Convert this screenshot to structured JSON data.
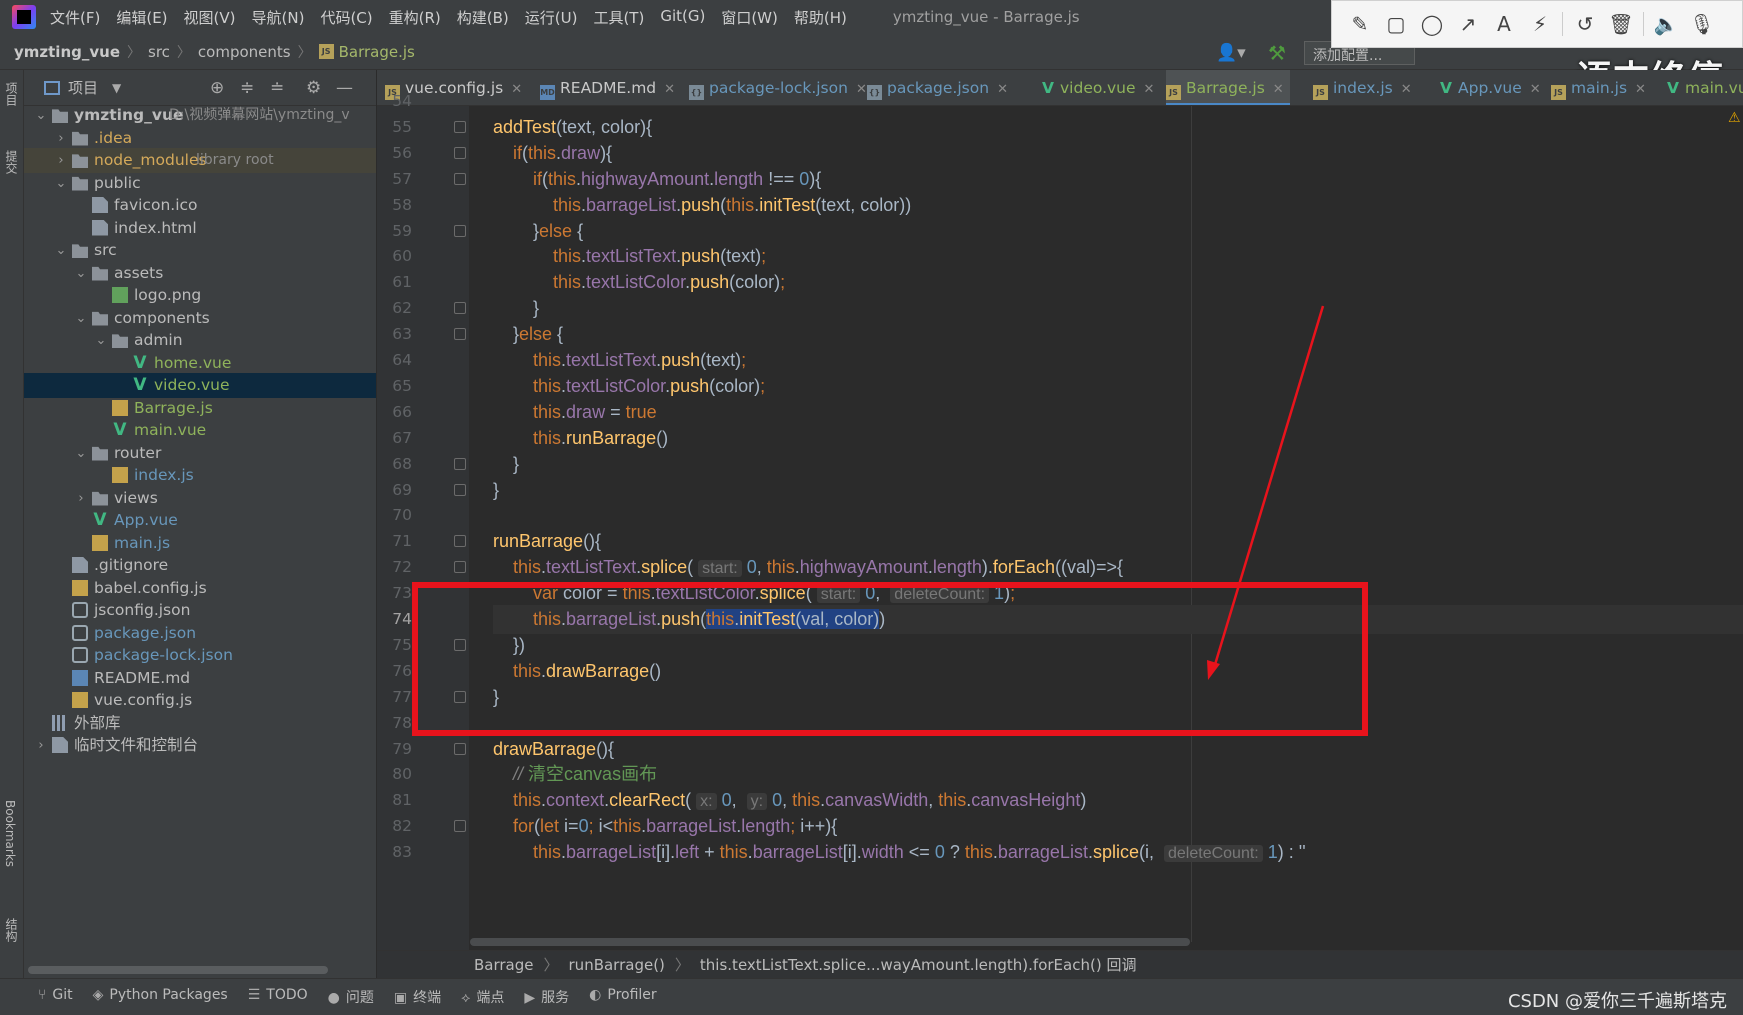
{
  "menubar": {
    "items": [
      "文件(F)",
      "编辑(E)",
      "视图(V)",
      "导航(N)",
      "代码(C)",
      "重构(R)",
      "构建(B)",
      "运行(U)",
      "工具(T)",
      "Git(G)",
      "窗口(W)",
      "帮助(H)"
    ],
    "title": "ymzting_vue - Barrage.js"
  },
  "navbar": {
    "crumbs": [
      "ymzting_vue",
      "src",
      "components",
      "Barrage.js"
    ],
    "run_config": "添加配置..."
  },
  "annotation_toolbar": {
    "tools": [
      "pencil-icon",
      "rectangle-icon",
      "circle-icon",
      "arrow-icon",
      "text-icon",
      "magic-wand-icon",
      "undo-icon",
      "trash-icon",
      "speaker-icon",
      "microphone-icon"
    ]
  },
  "watermark": "语末终停",
  "left_strip": {
    "project": "项目",
    "commit": "提交",
    "bookmarks": "Bookmarks",
    "structure": "结构"
  },
  "project_panel": {
    "title": "项目"
  },
  "tree": [
    {
      "label": "ymzting_vue",
      "extra": "D:\\视频弹幕网站\\ymzting_v",
      "depth": 0,
      "kind": "project",
      "open": true
    },
    {
      "label": ".idea",
      "depth": 1,
      "kind": "folder",
      "open": false,
      "color": "idea"
    },
    {
      "label": "node_modules",
      "extra": "library root",
      "depth": 1,
      "kind": "folder",
      "open": false,
      "color": "lib"
    },
    {
      "label": "public",
      "depth": 1,
      "kind": "folder",
      "open": true
    },
    {
      "label": "favicon.ico",
      "depth": 2,
      "kind": "file"
    },
    {
      "label": "index.html",
      "depth": 2,
      "kind": "file"
    },
    {
      "label": "src",
      "depth": 1,
      "kind": "folder",
      "open": true
    },
    {
      "label": "assets",
      "depth": 2,
      "kind": "folder",
      "open": true
    },
    {
      "label": "logo.png",
      "depth": 3,
      "kind": "image"
    },
    {
      "label": "components",
      "depth": 2,
      "kind": "folder",
      "open": true
    },
    {
      "label": "admin",
      "depth": 3,
      "kind": "folder",
      "open": true
    },
    {
      "label": "home.vue",
      "depth": 4,
      "kind": "vue",
      "color": "green"
    },
    {
      "label": "video.vue",
      "depth": 4,
      "kind": "vue",
      "color": "green",
      "selected": true
    },
    {
      "label": "Barrage.js",
      "depth": 3,
      "kind": "js",
      "color": "green"
    },
    {
      "label": "main.vue",
      "depth": 3,
      "kind": "vue",
      "color": "green"
    },
    {
      "label": "router",
      "depth": 2,
      "kind": "folder",
      "open": true
    },
    {
      "label": "index.js",
      "depth": 3,
      "kind": "js",
      "color": "blue"
    },
    {
      "label": "views",
      "depth": 2,
      "kind": "folder"
    },
    {
      "label": "App.vue",
      "depth": 2,
      "kind": "vue",
      "color": "blue"
    },
    {
      "label": "main.js",
      "depth": 2,
      "kind": "js",
      "color": "blue"
    },
    {
      "label": ".gitignore",
      "depth": 1,
      "kind": "file"
    },
    {
      "label": "babel.config.js",
      "depth": 1,
      "kind": "js"
    },
    {
      "label": "jsconfig.json",
      "depth": 1,
      "kind": "json"
    },
    {
      "label": "package.json",
      "depth": 1,
      "kind": "json",
      "color": "blue"
    },
    {
      "label": "package-lock.json",
      "depth": 1,
      "kind": "json",
      "color": "blue"
    },
    {
      "label": "README.md",
      "depth": 1,
      "kind": "md"
    },
    {
      "label": "vue.config.js",
      "depth": 1,
      "kind": "js"
    },
    {
      "label": "外部库",
      "depth": 0,
      "kind": "lib"
    },
    {
      "label": "临时文件和控制台",
      "depth": 0,
      "kind": "scratch",
      "open": false
    }
  ],
  "tabs": [
    {
      "label": "vue.config.js",
      "kind": "js"
    },
    {
      "label": "README.md",
      "kind": "md"
    },
    {
      "label": "package-lock.json",
      "kind": "json",
      "color": "blue"
    },
    {
      "label": "package.json",
      "kind": "json",
      "color": "blue"
    },
    {
      "label": "video.vue",
      "kind": "vue",
      "color": "green"
    },
    {
      "label": "Barrage.js",
      "kind": "js",
      "color": "green",
      "active": true
    },
    {
      "label": "index.js",
      "kind": "js",
      "color": "blue"
    },
    {
      "label": "App.vue",
      "kind": "vue",
      "color": "blue"
    },
    {
      "label": "main.js",
      "kind": "js",
      "color": "blue"
    },
    {
      "label": "main.vue",
      "kind": "vue",
      "color": "green"
    }
  ],
  "editor": {
    "current_line": 74,
    "lines": [
      {
        "n": 54,
        "html": ""
      },
      {
        "n": 55,
        "html": "<span class='fn'>addTest</span>(text, color){"
      },
      {
        "n": 56,
        "html": "    <span class='kw'>if</span>(<span class='kw'>this</span>.<span class='pr'>draw</span>){"
      },
      {
        "n": 57,
        "html": "        <span class='kw'>if</span>(<span class='kw'>this</span>.<span class='pr'>highwayAmount</span>.<span class='pr'>length</span> !== <span class='num'>0</span>){"
      },
      {
        "n": 58,
        "html": "            <span class='kw'>this</span>.<span class='pr'>barrageList</span>.<span class='fn'>push</span>(<span class='kw'>this</span>.<span class='fn'>initTest</span>(text, color))"
      },
      {
        "n": 59,
        "html": "        }<span class='kw'>else</span> {"
      },
      {
        "n": 60,
        "html": "            <span class='kw'>this</span>.<span class='pr'>textListText</span>.<span class='fn'>push</span>(text)<span class='kw'>;</span>"
      },
      {
        "n": 61,
        "html": "            <span class='kw'>this</span>.<span class='pr'>textListColor</span>.<span class='fn'>push</span>(color)<span class='kw'>;</span>"
      },
      {
        "n": 62,
        "html": "        }"
      },
      {
        "n": 63,
        "html": "    }<span class='kw'>else</span> {"
      },
      {
        "n": 64,
        "html": "        <span class='kw'>this</span>.<span class='pr'>textListText</span>.<span class='fn'>push</span>(text)<span class='kw'>;</span>"
      },
      {
        "n": 65,
        "html": "        <span class='kw'>this</span>.<span class='pr'>textListColor</span>.<span class='fn'>push</span>(color)<span class='kw'>;</span>"
      },
      {
        "n": 66,
        "html": "        <span class='kw'>this</span>.<span class='pr'>draw</span> = <span class='kw'>true</span>"
      },
      {
        "n": 67,
        "html": "        <span class='kw'>this</span>.<span class='fn'>runBarrage</span>()"
      },
      {
        "n": 68,
        "html": "    }"
      },
      {
        "n": 69,
        "html": "}"
      },
      {
        "n": 70,
        "html": ""
      },
      {
        "n": 71,
        "html": "<span class='fn'>runBarrage</span>(){"
      },
      {
        "n": 72,
        "html": "    <span class='kw'>this</span>.<span class='pr'>textListText</span>.<span class='fn'>splice</span>( <span class='hint'>start:</span> <span class='num'>0</span>, <span class='kw'>this</span>.<span class='pr'>highwayAmount</span>.<span class='pr'>length</span>).<span class='fn'>forEach</span>((val)=>{"
      },
      {
        "n": 73,
        "html": "        <span class='kw'>var</span> color = <span class='kw'>this</span>.<span class='pr'>textListColor</span>.<span class='fn'>splice</span>( <span class='hint'>start:</span> <span class='num'>0</span>,  <span class='hint'>deleteCount:</span> <span class='num'>1</span>)<span class='kw'>;</span>"
      },
      {
        "n": 74,
        "html": "        <span class='kw'>this</span>.<span class='pr'>barrageList</span>.<span class='fn'>push</span>(<span class='sel-text'><span class='kw'>this</span>.<span class='fn'>initTest</span>(val, color)</span>)"
      },
      {
        "n": 75,
        "html": "    })"
      },
      {
        "n": 76,
        "html": "    <span class='kw'>this</span>.<span class='fn'>drawBarrage</span>()"
      },
      {
        "n": 77,
        "html": "}"
      },
      {
        "n": 78,
        "html": ""
      },
      {
        "n": 79,
        "html": "<span class='fn'>drawBarrage</span>(){"
      },
      {
        "n": 80,
        "html": "    <span class='cm'>// </span><span class='cmcn'>清空canvas画布</span>"
      },
      {
        "n": 81,
        "html": "    <span class='kw'>this</span>.<span class='pr'>context</span>.<span class='fn'>clearRect</span>( <span class='hint'>x:</span> <span class='num'>0</span>,  <span class='hint'>y:</span> <span class='num'>0</span>, <span class='kw'>this</span>.<span class='pr'>canvasWidth</span>, <span class='kw'>this</span>.<span class='pr'>canvasHeight</span>)"
      },
      {
        "n": 82,
        "html": "    <span class='kw'>for</span>(<span class='kw'>let</span> i=<span class='num'>0</span><span class='kw'>;</span> i&lt;<span class='kw'>this</span>.<span class='pr'>barrageList</span>.<span class='pr'>length</span><span class='kw'>;</span> i++){"
      },
      {
        "n": 83,
        "html": "        <span class='kw'>this</span>.<span class='pr'>barrageList</span>[i].<span class='pr'>left</span> + <span class='kw'>this</span>.<span class='pr'>barrageList</span>[i].<span class='pr'>width</span> &lt;= <span class='num'>0</span> ? <span class='kw'>this</span>.<span class='pr'>barrageList</span>.<span class='fn'>splice</span>(i,  <span class='hint'>deleteCount:</span> <span class='num'>1</span>) : ''"
      }
    ]
  },
  "editor_breadcrumb": [
    "Barrage",
    "runBarrage()",
    "this.textListText.splice...wayAmount.length).forEach() 回调"
  ],
  "bottombar": {
    "items": [
      {
        "icon": "git-icon",
        "label": "Git"
      },
      {
        "icon": "python-packages-icon",
        "label": "Python Packages"
      },
      {
        "icon": "todo-icon",
        "label": "TODO"
      },
      {
        "icon": "problems-icon",
        "label": "问题"
      },
      {
        "icon": "terminal-icon",
        "label": "终端"
      },
      {
        "icon": "endpoints-icon",
        "label": "端点"
      },
      {
        "icon": "services-icon",
        "label": "服务"
      },
      {
        "icon": "profiler-icon",
        "label": "Profiler"
      }
    ],
    "credit": "CSDN @爱你三千遍斯塔克"
  },
  "colors": {
    "annotation_red": "#e8131c",
    "keyword": "#cc7832",
    "function": "#ffc66d",
    "property": "#9876aa",
    "number": "#6897bb",
    "selection": "#214283"
  }
}
